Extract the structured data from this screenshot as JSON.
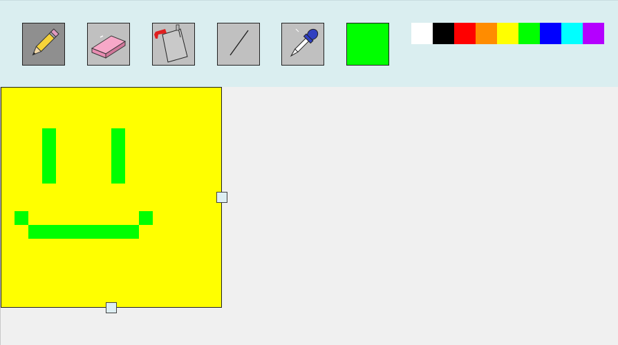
{
  "toolbar": {
    "tools": [
      {
        "id": "pencil",
        "icon": "pencil-icon",
        "active": true
      },
      {
        "id": "eraser",
        "icon": "eraser-icon",
        "active": false
      },
      {
        "id": "fill",
        "icon": "paint-bucket-icon",
        "active": false
      },
      {
        "id": "line",
        "icon": "line-icon",
        "active": false
      },
      {
        "id": "picker",
        "icon": "eyedropper-icon",
        "active": false
      }
    ],
    "current_color": "#00ff00",
    "palette": [
      "#ffffff",
      "#000000",
      "#ff0000",
      "#ff8c00",
      "#ffff00",
      "#00ff00",
      "#0000ff",
      "#00ffff",
      "#b400ff"
    ]
  },
  "canvas": {
    "background": "#ffff00",
    "pixel_color": "#00ff00",
    "grid_size": 16,
    "pixels": [
      [
        3,
        3
      ],
      [
        3,
        4
      ],
      [
        3,
        5
      ],
      [
        3,
        6
      ],
      [
        8,
        3
      ],
      [
        8,
        4
      ],
      [
        8,
        5
      ],
      [
        8,
        6
      ],
      [
        1,
        9
      ],
      [
        10,
        9
      ],
      [
        2,
        10
      ],
      [
        3,
        10
      ],
      [
        4,
        10
      ],
      [
        5,
        10
      ],
      [
        6,
        10
      ],
      [
        7,
        10
      ],
      [
        8,
        10
      ],
      [
        9,
        10
      ]
    ]
  }
}
